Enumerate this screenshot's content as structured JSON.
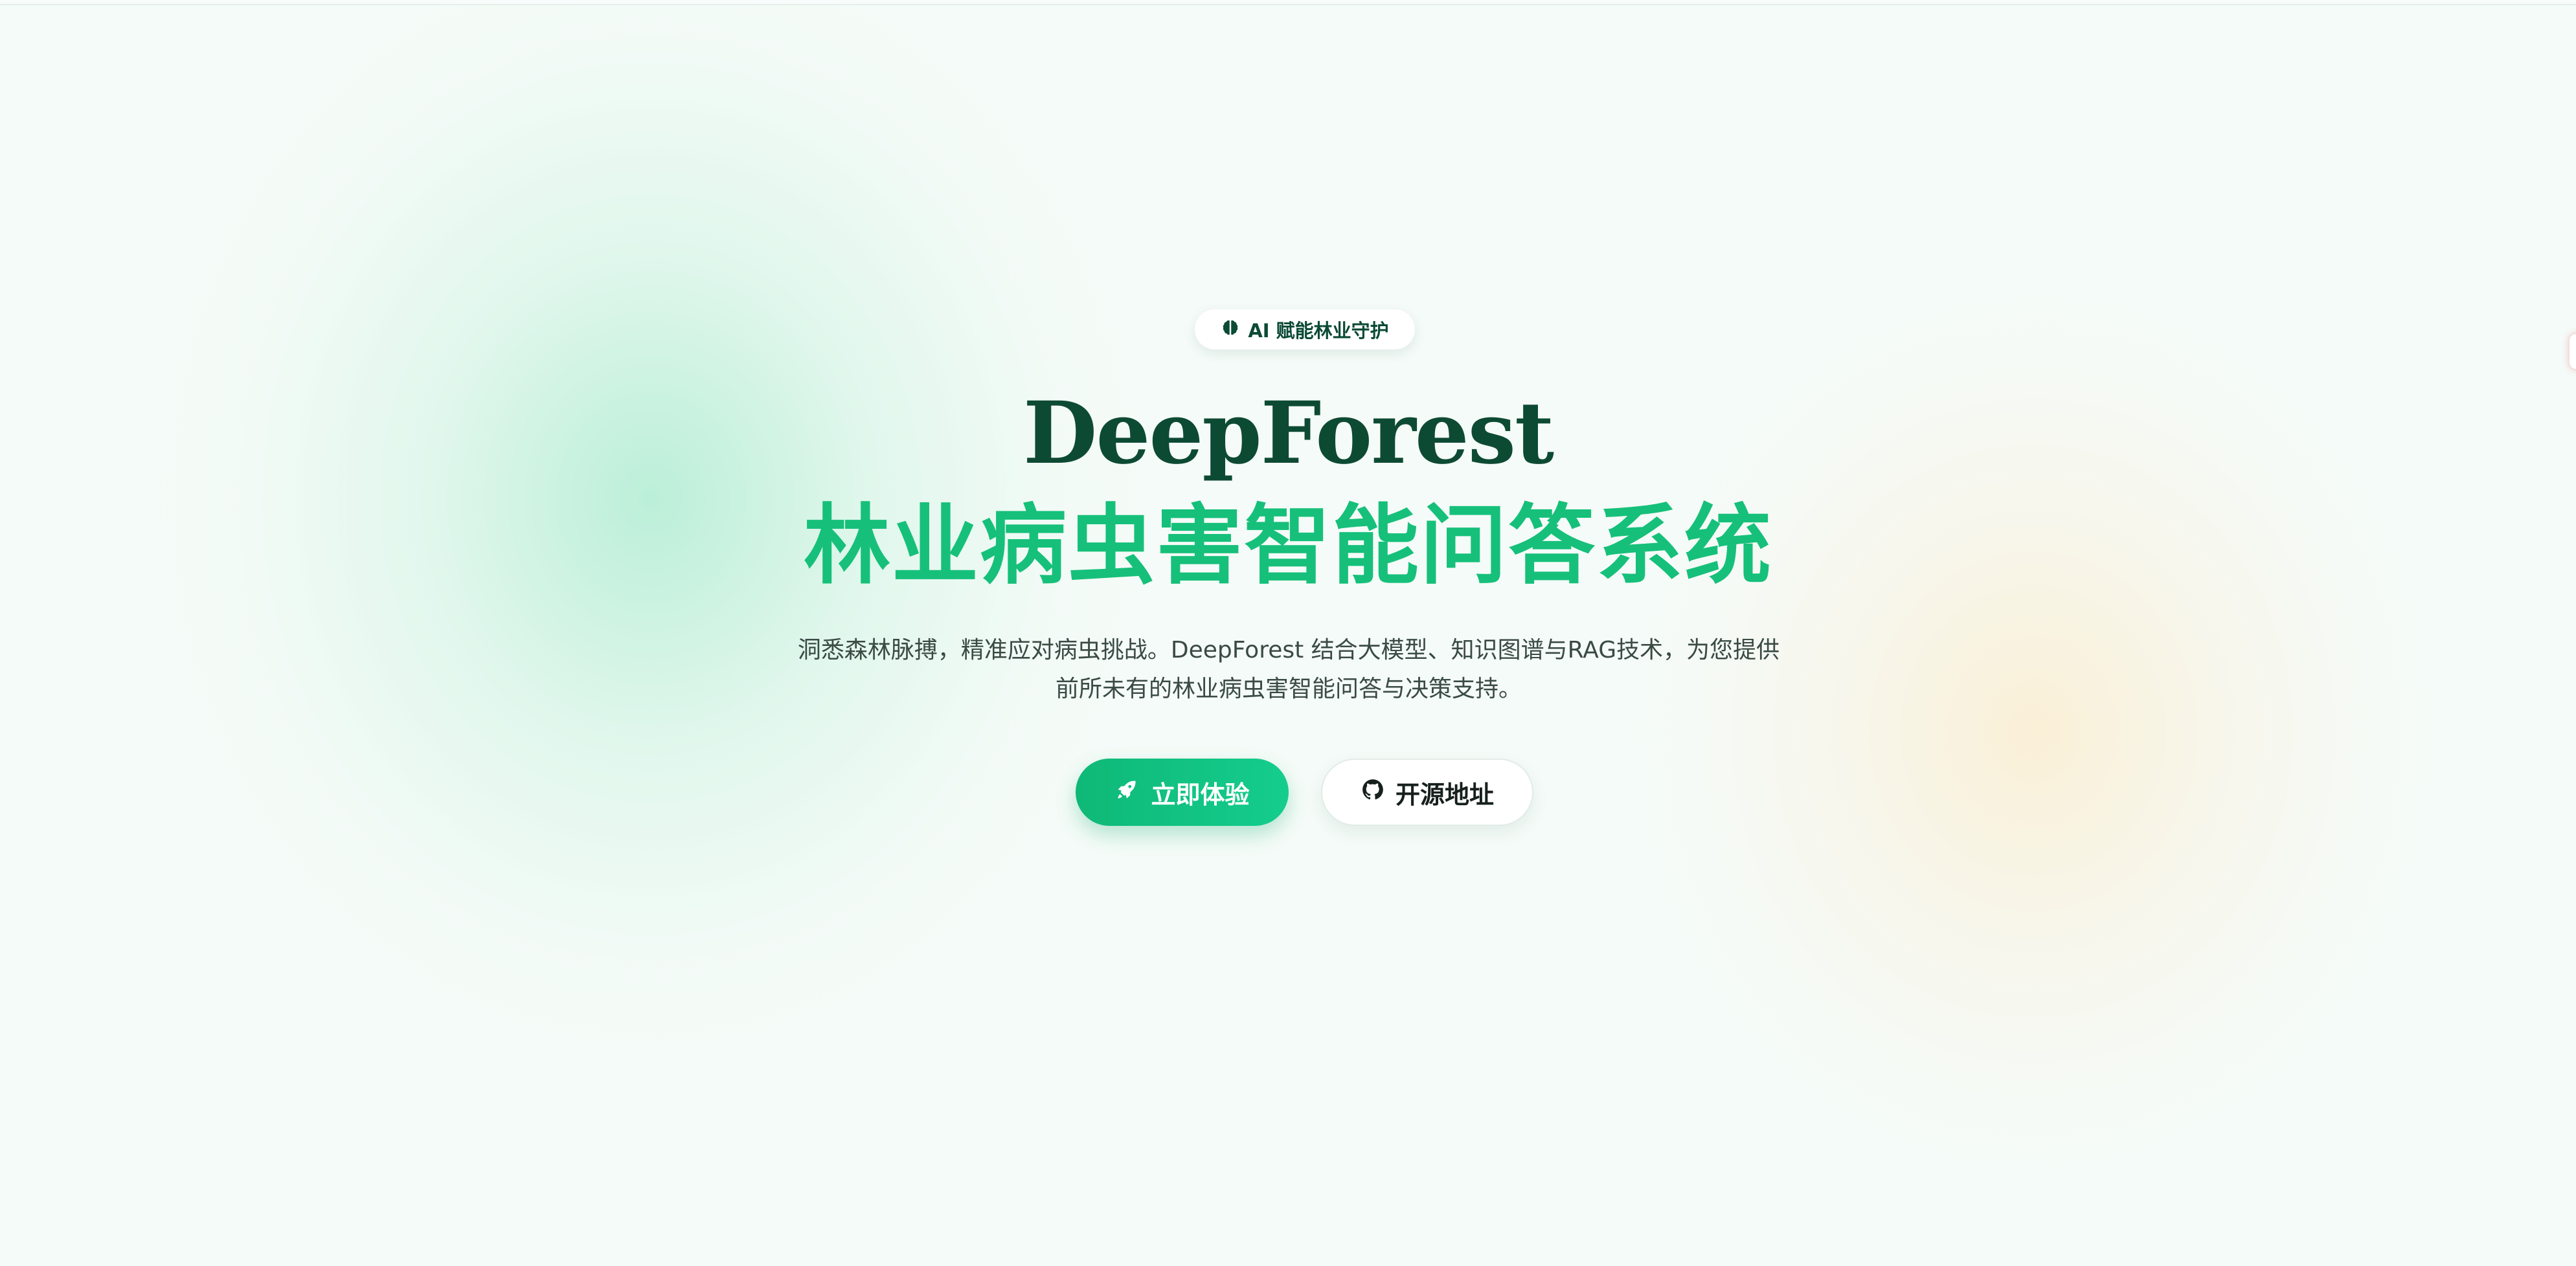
{
  "badge": {
    "icon": "brain-icon",
    "label": "AI 赋能林业守护"
  },
  "hero": {
    "title_en": "DeepForest",
    "title_zh": "林业病虫害智能问答系统",
    "description": "洞悉森林脉搏，精准应对病虫挑战。DeepForest 结合大模型、知识图谱与RAG技术，为您提供前所未有的林业病虫害智能问答与决策支持。"
  },
  "buttons": {
    "primary": {
      "label": "立即体验",
      "icon": "rocket-icon"
    },
    "secondary": {
      "label": "开源地址",
      "icon": "github-icon"
    }
  },
  "colors": {
    "accent": "#16c07a",
    "title_dark": "#0d4a34",
    "primary_button": "#10bd7d"
  }
}
